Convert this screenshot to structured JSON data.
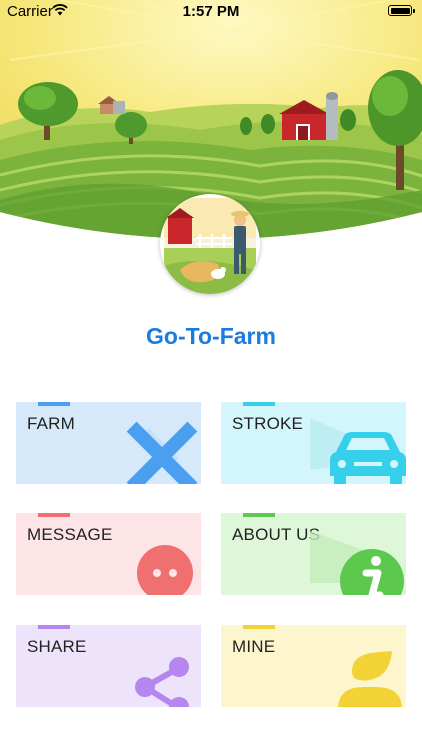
{
  "status_bar": {
    "carrier": "Carrier",
    "time": "1:57 PM"
  },
  "app": {
    "title": "Go-To-Farm"
  },
  "menu": [
    {
      "label": "FARM",
      "icon": "windmill-icon",
      "bg": "#d6e9fb",
      "accent": "#4a9ff0"
    },
    {
      "label": "STROKE",
      "icon": "car-icon",
      "bg": "#d2f6fb",
      "accent": "#36d0ec"
    },
    {
      "label": "MESSAGE",
      "icon": "chat-bubble-icon",
      "bg": "#fde4e6",
      "accent": "#f07070"
    },
    {
      "label": "ABOUT US",
      "icon": "info-icon",
      "bg": "#def7d9",
      "accent": "#5cc84e"
    },
    {
      "label": "SHARE",
      "icon": "share-icon",
      "bg": "#ede3fb",
      "accent": "#b586ee"
    },
    {
      "label": "MINE",
      "icon": "user-icon",
      "bg": "#fdf5cc",
      "accent": "#f2d235"
    }
  ]
}
